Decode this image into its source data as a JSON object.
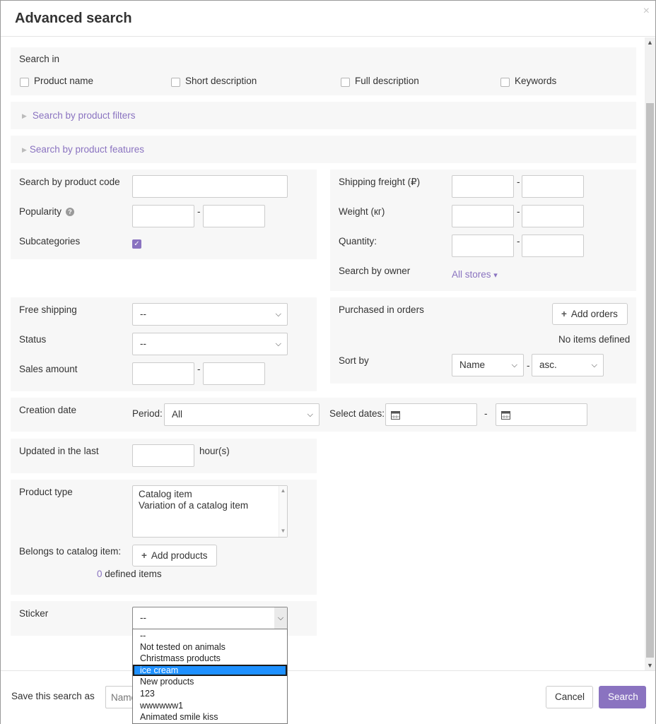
{
  "dialog": {
    "title": "Advanced search",
    "close_glyph": "×"
  },
  "search_in": {
    "label": "Search in",
    "options": [
      "Product name",
      "Short description",
      "Full description",
      "Keywords"
    ]
  },
  "sections": {
    "filters": "Search by product filters",
    "features": "Search by product features"
  },
  "left_block1": {
    "product_code": "Search by product code",
    "popularity": "Popularity",
    "subcategories": "Subcategories"
  },
  "right_block1": {
    "shipping_freight": "Shipping freight (₽)",
    "weight": "Weight (кг)",
    "quantity": "Quantity:",
    "owner": "Search by owner",
    "owner_value": "All stores",
    "owner_caret": "▾"
  },
  "left_block2": {
    "free_shipping": "Free shipping",
    "free_shipping_value": "--",
    "status": "Status",
    "status_value": "--",
    "sales_amount": "Sales amount"
  },
  "right_block2": {
    "purchased": "Purchased in orders",
    "add_orders": "Add orders",
    "no_items": "No items defined",
    "sort_by": "Sort by",
    "sort_field": "Name",
    "sort_dir": "asc."
  },
  "creation": {
    "label": "Creation date",
    "period_label": "Period:",
    "period_value": "All",
    "select_dates": "Select dates:"
  },
  "updated": {
    "label": "Updated in the last",
    "unit": "hour(s)"
  },
  "product_type": {
    "label": "Product type",
    "options": [
      "Catalog item",
      "Variation of a catalog item"
    ],
    "belongs": "Belongs to catalog item:",
    "add_products": "Add products",
    "count": "0",
    "defined_items": "defined items"
  },
  "sticker": {
    "label": "Sticker",
    "value": "--",
    "options": [
      "--",
      "Not tested on animals",
      "Christmass products",
      "ice cream",
      "New products",
      "123",
      "wwwwww1",
      "Animated smile kiss"
    ],
    "highlighted_index": 3
  },
  "footer": {
    "save_label": "Save this search as",
    "name_placeholder": "Name",
    "cancel": "Cancel",
    "search": "Search"
  },
  "colors": {
    "accent": "#8a73c0",
    "highlight": "#1e90ff"
  },
  "icons": [
    "close-icon",
    "help-icon",
    "plus-icon",
    "calendar-icon",
    "chevron-down-icon",
    "checkmark-icon"
  ]
}
